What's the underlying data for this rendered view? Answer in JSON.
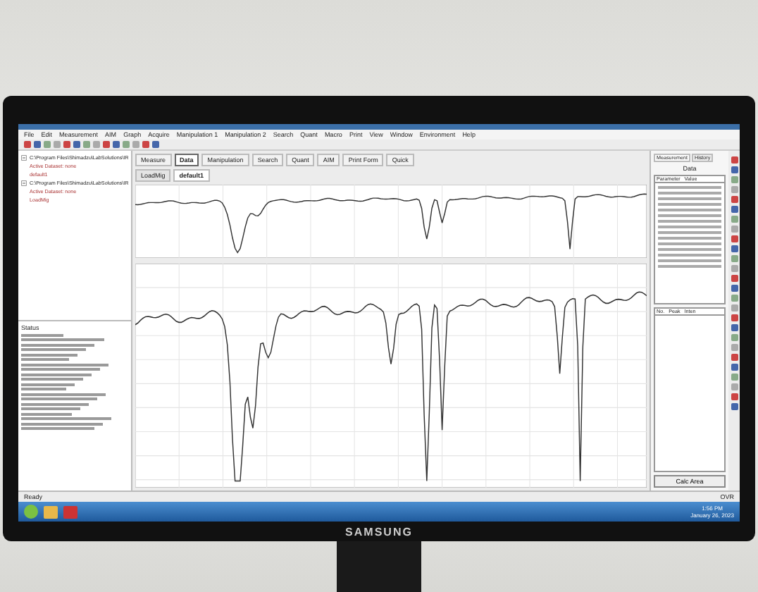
{
  "monitor": {
    "brand": "SAMSUNG"
  },
  "menu": [
    "File",
    "Edit",
    "Measurement",
    "AIM",
    "Graph",
    "Acquire",
    "Manipulation 1",
    "Manipulation 2",
    "Search",
    "Quant",
    "Macro",
    "Print",
    "View",
    "Window",
    "Environment",
    "Help"
  ],
  "mode_tabs": [
    {
      "label": "Measure",
      "selected": false
    },
    {
      "label": "Data",
      "selected": true
    },
    {
      "label": "Manipulation",
      "selected": false
    },
    {
      "label": "Search",
      "selected": false
    },
    {
      "label": "Quant",
      "selected": false
    },
    {
      "label": "AIM",
      "selected": false
    },
    {
      "label": "Print Form",
      "selected": false
    },
    {
      "label": "Quick",
      "selected": false
    }
  ],
  "data_tabs": [
    {
      "label": "LoadMig",
      "selected": false
    },
    {
      "label": "default1",
      "selected": true
    }
  ],
  "tree": [
    {
      "label": "C:\\Program Files\\Shimadzu\\LabSolutions\\IR",
      "expanded": true,
      "children": [
        {
          "label": "Active Dataset: none"
        },
        {
          "label": "default1"
        }
      ]
    },
    {
      "label": "C:\\Program Files\\Shimadzu\\LabSolutions\\IR",
      "expanded": true,
      "children": [
        {
          "label": "Active Dataset: none"
        },
        {
          "label": "LoadMig"
        }
      ]
    }
  ],
  "log_title": "Status",
  "panel_tabs": [
    {
      "label": "Measurement",
      "selected": true
    },
    {
      "label": "History",
      "selected": false
    }
  ],
  "panel_subtitle": "Data",
  "param_columns": [
    "Parameter",
    "Value"
  ],
  "peak_columns": [
    "No.",
    "Peak",
    "Inten"
  ],
  "calc_button": "Calc Area",
  "status_bar": {
    "left": "Ready",
    "right": "OVR"
  },
  "taskbar": {
    "time": "1:56 PM",
    "date": "January 26, 2023"
  }
}
